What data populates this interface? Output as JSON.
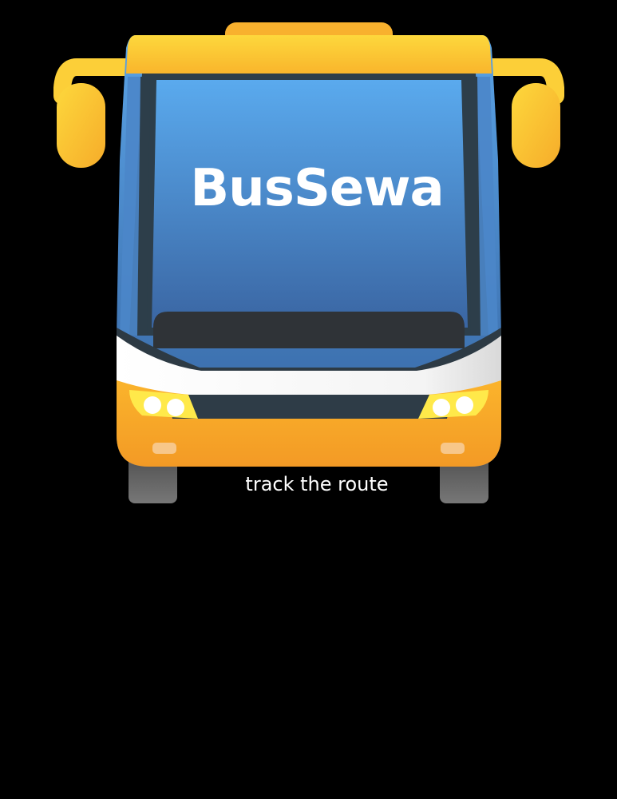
{
  "app": {
    "title": "BusSewa",
    "tagline": "track the route"
  },
  "illustration": {
    "name": "bus-front-icon"
  },
  "colors": {
    "background": "#000000",
    "bus_yellow": "#fdd43a",
    "bus_orange": "#f7a42a",
    "windshield_top": "#5aa7ea",
    "windshield_bottom": "#3a6aa6",
    "text": "#ffffff"
  }
}
